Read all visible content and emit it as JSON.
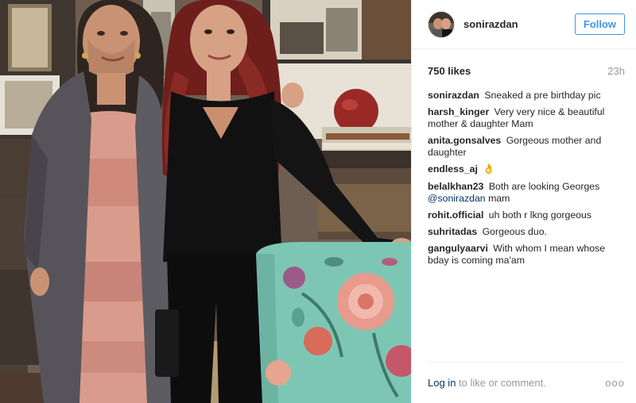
{
  "post": {
    "username": "sonirazdan",
    "follow_label": "Follow",
    "likes": "750 likes",
    "time_ago": "23h"
  },
  "comments": [
    {
      "author": "sonirazdan",
      "text": "Sneaked a pre birthday pic"
    },
    {
      "author": "harsh_kinger",
      "text": "Very very nice & beautiful mother & daughter Mam"
    },
    {
      "author": "anita.gonsalves",
      "text": "Gorgeous mother and daughter"
    },
    {
      "author": "endless_aj",
      "text": "👌"
    },
    {
      "author": "belalkhan23",
      "text": "Both are looking Georges",
      "mention": "@sonirazdan",
      "text_after": "mam"
    },
    {
      "author": "rohit.official",
      "text": "uh both r lkng gorgeous"
    },
    {
      "author": "suhritadas",
      "text": "Gorgeous duo."
    },
    {
      "author": "gangulyaarvi",
      "text": "With whom I mean whose bday is coming ma'am"
    }
  ],
  "footer": {
    "login_link": "Log in",
    "login_rest": "to like or comment.",
    "more_label": "ooo"
  },
  "colors": {
    "link_blue": "#3897f0",
    "dark_link": "#003569",
    "muted_gray": "#999999",
    "text_dark": "#262626"
  },
  "icons": {
    "more": "more-options-icon",
    "emoji": "ok-hand-emoji"
  }
}
